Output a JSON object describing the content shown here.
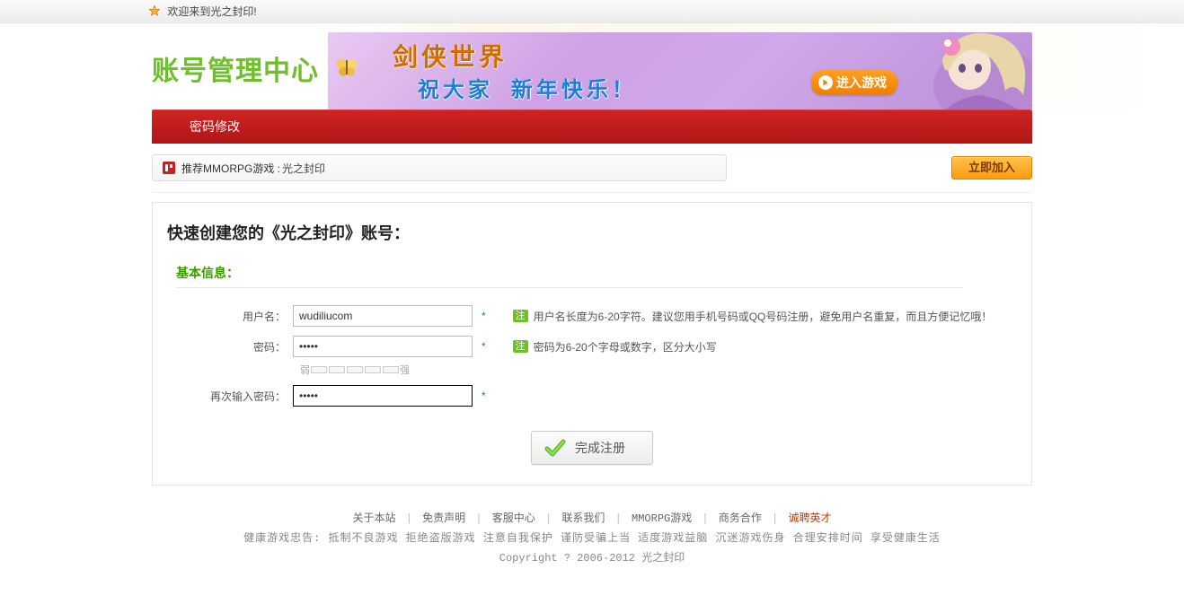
{
  "topbar": {
    "welcome": "欢迎来到光之封印!"
  },
  "header": {
    "logo": "账号管理中心",
    "banner_title": "剑侠世界",
    "banner_sub1": "祝大家",
    "banner_sub2": "新年快乐！",
    "enter_game": "进入游戏"
  },
  "redbar": {
    "title": "密码修改"
  },
  "recommend": {
    "label_prefix": "推荐MMORPG游戏 :",
    "game_name": "光之封印",
    "join_label": "立即加入"
  },
  "panel": {
    "title": "快速创建您的《光之封印》账号：",
    "section": "基本信息："
  },
  "form": {
    "username_label": "用户名：",
    "username_value": "wudiliucom",
    "username_hint_badge": "注",
    "username_hint": "用户名长度为6-20字符。建议您用手机号码或QQ号码注册，避免用户名重复，而且方便记忆哦！",
    "password_label": "密码：",
    "password_value": "•••••",
    "password_hint_badge": "注",
    "password_hint": "密码为6-20个字母或数字，区分大小写",
    "strength_weak": "弱",
    "strength_strong": "强",
    "password2_label": "再次输入密码：",
    "password2_value": "•••••",
    "required_mark": "*",
    "submit_label": "完成注册"
  },
  "footer": {
    "links": [
      "关于本站",
      "免责声明",
      "客服中心",
      "联系我们",
      "MMORPG游戏",
      "商务合作",
      "诚聘英才"
    ],
    "highlight_index": 6,
    "line2": "健康游戏忠告: 抵制不良游戏 拒绝盗版游戏 注意自我保护 谨防受骗上当 适度游戏益脑 沉迷游戏伤身 合理安排时间 享受健康生活",
    "copyright": "Copyright ? 2006-2012 光之封印"
  }
}
